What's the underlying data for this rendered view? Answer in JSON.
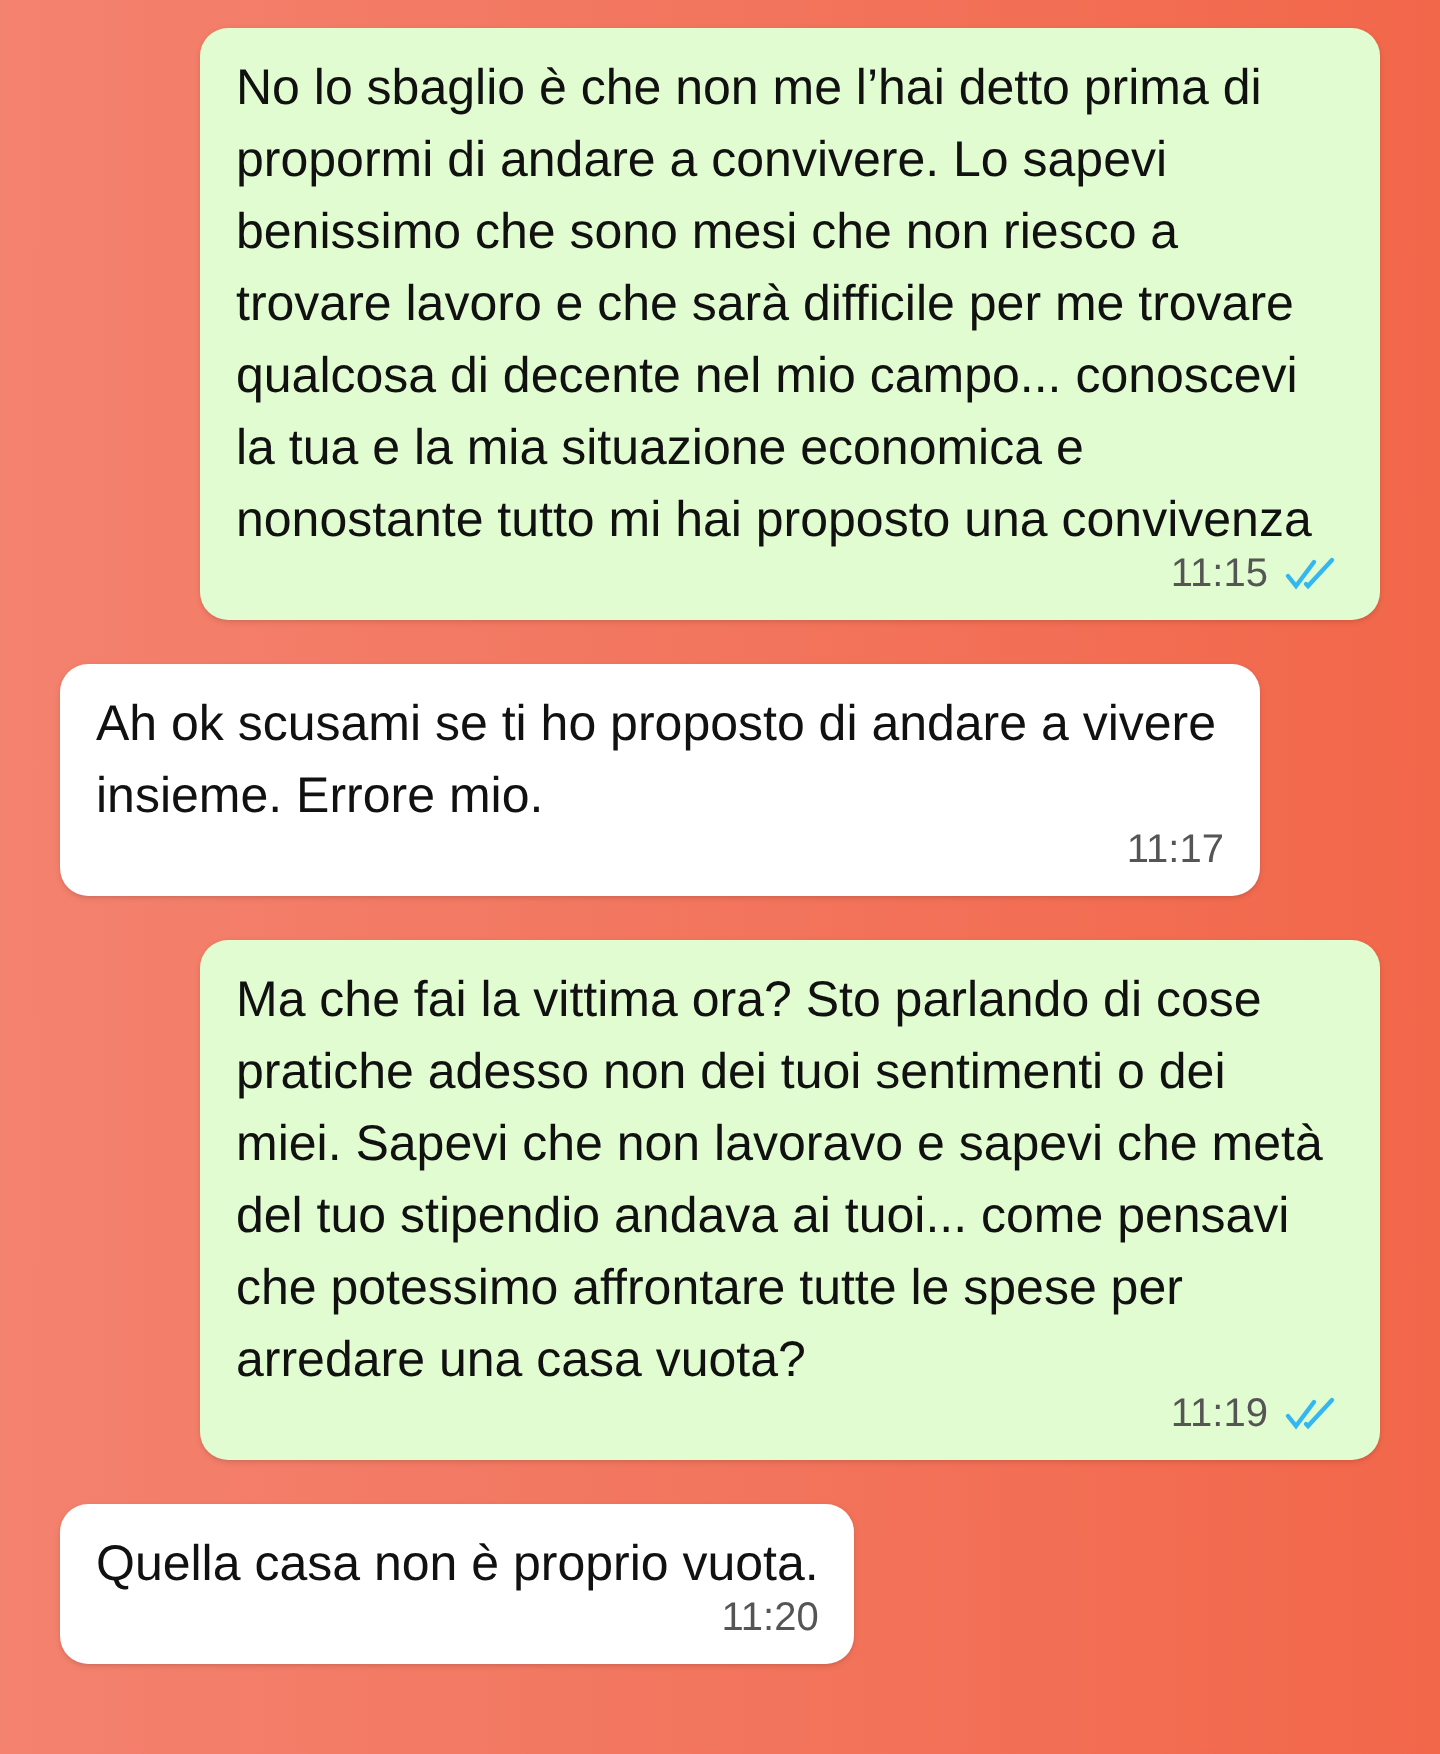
{
  "messages": [
    {
      "kind": "outgoing",
      "text": "No lo sbaglio è che non me l’hai detto prima di propormi di andare a convivere. Lo sapevi benissimo che sono mesi che non riesco a trovare lavoro e che sarà difficile per me trovare qualcosa di decente nel mio campo... conoscevi la tua e la mia situazione economica e nonostante tutto mi hai proposto una convivenza",
      "time": "11:15",
      "read": true
    },
    {
      "kind": "incoming",
      "text": "Ah ok scusami se ti ho proposto di andare a vivere insieme. Errore mio.",
      "time": "11:17"
    },
    {
      "kind": "outgoing",
      "text": "Ma che fai la vittima ora? Sto parlando di cose pratiche adesso non dei tuoi sentimenti o dei miei. Sapevi che non lavoravo e sapevi che metà del tuo stipendio andava ai tuoi... come pensavi che potessimo affrontare tutte le spese per arredare una casa vuota?",
      "time": "11:19",
      "read": true
    },
    {
      "kind": "incoming",
      "text": "Quella casa non è proprio vuota.",
      "time": "11:20"
    }
  ]
}
